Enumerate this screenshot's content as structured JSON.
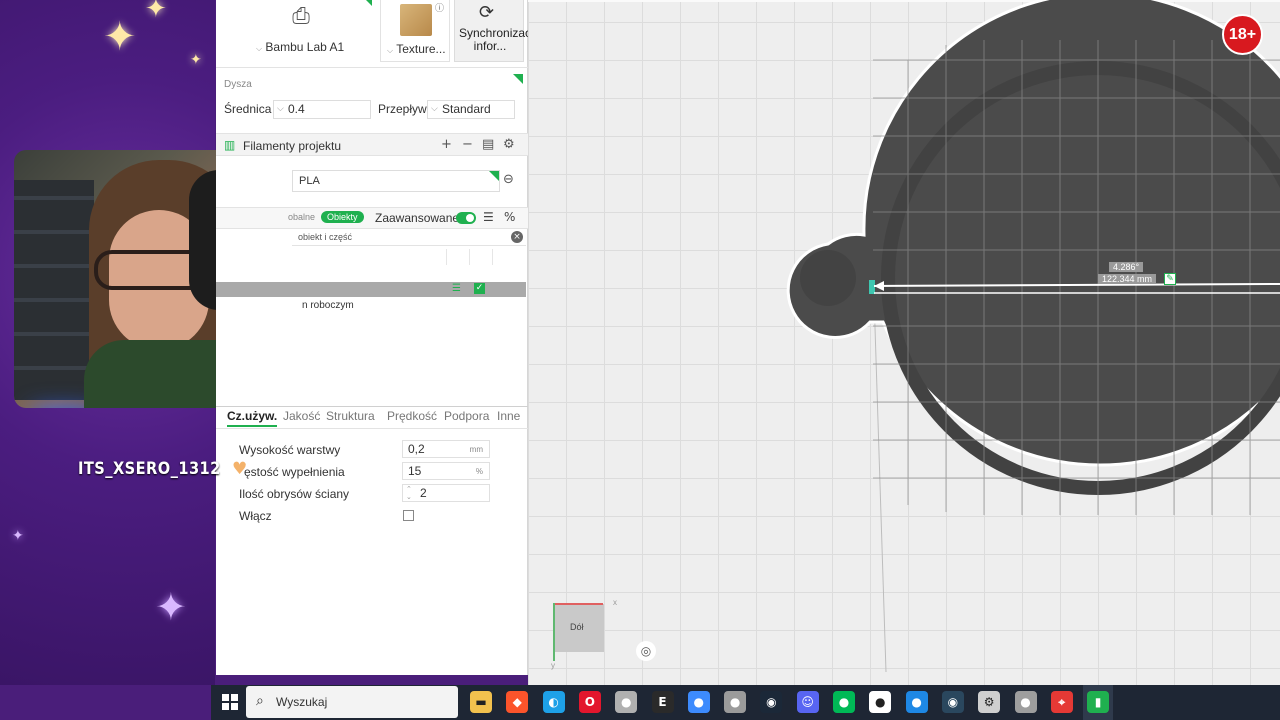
{
  "app": {
    "printer": {
      "name": "Bambu Lab A1"
    },
    "plate": {
      "label": "Texture..."
    },
    "sync": {
      "label": "Synchronizacja infor..."
    },
    "nozzle": {
      "section_title": "Dysza",
      "diameter_label": "Średnica",
      "diameter_value": "0.4",
      "flow_label": "Przepływ",
      "flow_value": "Standard"
    },
    "filaments": {
      "title": "Filamenty projektu",
      "items": [
        {
          "name": "PLA"
        }
      ]
    },
    "mode": {
      "global_label": "obalne",
      "objects_label": "Obiekty",
      "advanced_label": "Zaawansowane"
    },
    "object_search": {
      "text": "obiekt i część"
    },
    "object_list": {
      "sub_item": "n roboczym"
    },
    "settings_tabs": [
      "Cz.używ.",
      "Jakość",
      "Struktura",
      "Prędkość",
      "Podpora",
      "Inne"
    ],
    "params": [
      {
        "label": "Wysokość warstwy",
        "value": "0,2",
        "unit": "mm"
      },
      {
        "label": "ęstość wypełnienia",
        "value": "15",
        "unit": "%"
      },
      {
        "label": "Ilość obrysów ściany",
        "value": "2",
        "unit": ""
      },
      {
        "label": "Włącz",
        "value": "",
        "unit": ""
      }
    ],
    "viewport": {
      "measure_angle": "4.286°",
      "measure_length": "122.344 mm",
      "view_cube_face": "Dół",
      "axis_x": "x",
      "axis_y": "y"
    }
  },
  "stream": {
    "username": "ITS_XSERO_1312",
    "age_badge": "18+"
  },
  "taskbar": {
    "search_placeholder": "Wyszukaj",
    "apps": [
      {
        "icon": "file-explorer-icon",
        "color": "#f2c14e"
      },
      {
        "icon": "brave-icon",
        "color": "#fb542b"
      },
      {
        "icon": "edge-icon",
        "color": "#1ea1e8"
      },
      {
        "icon": "opera-icon",
        "color": "#e3162d"
      },
      {
        "icon": "app-icon",
        "color": "#b0b0b0"
      },
      {
        "icon": "epic-games-icon",
        "color": "#2a2a2a"
      },
      {
        "icon": "app-icon",
        "color": "#3d8bfd"
      },
      {
        "icon": "app-icon",
        "color": "#9b9b9b"
      },
      {
        "icon": "steam-icon",
        "color": "#1b2838"
      },
      {
        "icon": "discord-icon",
        "color": "#5865f2"
      },
      {
        "icon": "app-icon",
        "color": "#00b956"
      },
      {
        "icon": "app-icon",
        "color": "#ffffff"
      },
      {
        "icon": "app-icon",
        "color": "#1e88e5"
      },
      {
        "icon": "steam-icon",
        "color": "#2a475e"
      },
      {
        "icon": "settings-icon",
        "color": "#cfcfcf"
      },
      {
        "icon": "app-icon",
        "color": "#9e9e9e"
      },
      {
        "icon": "maps-icon",
        "color": "#e53935"
      },
      {
        "icon": "bambu-studio-icon",
        "color": "#1fb04f"
      }
    ]
  },
  "colors": {
    "accent": "#1fb04f",
    "model_fill": "#4a4a4a",
    "taskbar": "#1e2634"
  }
}
